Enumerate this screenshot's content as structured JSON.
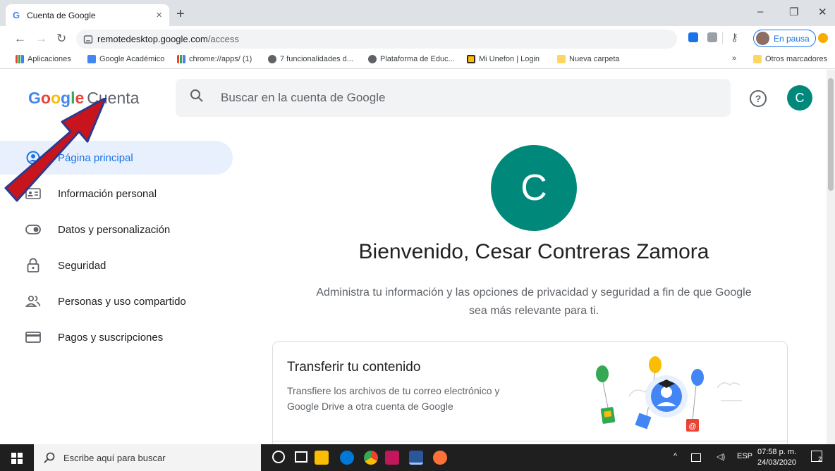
{
  "browser": {
    "tab_title": "Cuenta de Google",
    "tab_close": "×",
    "new_tab": "+",
    "window_minimize": "–",
    "window_restore": "❐",
    "window_close": "✕",
    "url_host": "remotedesktop.google.com",
    "url_path": "/access",
    "profile_status": "En pausa"
  },
  "bookmarks": [
    {
      "label": "Aplicaciones"
    },
    {
      "label": "Google Académico"
    },
    {
      "label": "chrome://apps/ (1)"
    },
    {
      "label": "7 funcionalidades d..."
    },
    {
      "label": "Plataforma de Educ..."
    },
    {
      "label": "Mi Unefon | Login"
    },
    {
      "label": "Nueva carpeta"
    }
  ],
  "bookmarks_overflow": "»",
  "other_bookmarks": "Otros marcadores",
  "header": {
    "logo_google": "Google",
    "logo_cuenta": "Cuenta",
    "search_placeholder": "Buscar en la cuenta de Google",
    "help": "?",
    "avatar_letter": "C"
  },
  "sidebar": {
    "items": [
      {
        "label": "Página principal",
        "icon": "account-circle-icon",
        "active": true
      },
      {
        "label": "Información personal",
        "icon": "id-card-icon"
      },
      {
        "label": "Datos y personalización",
        "icon": "toggle-icon"
      },
      {
        "label": "Seguridad",
        "icon": "lock-icon"
      },
      {
        "label": "Personas y uso compartido",
        "icon": "people-icon"
      },
      {
        "label": "Pagos y suscripciones",
        "icon": "credit-card-icon"
      }
    ]
  },
  "main": {
    "avatar_letter": "C",
    "welcome": "Bienvenido, Cesar Contreras Zamora",
    "subtitle_line1": "Administra tu información y las opciones de privacidad y seguridad a fin de que Google",
    "subtitle_line2": "sea más relevante para ti.",
    "card": {
      "title": "Transferir tu contenido",
      "desc_line1": "Transfiere los archivos de tu correo electrónico y",
      "desc_line2": "Google Drive a otra cuenta de Google"
    }
  },
  "taskbar": {
    "search_placeholder": "Escribe aquí para buscar",
    "language": "ESP",
    "time": "07:58 p. m.",
    "date": "24/03/2020",
    "notification_count": "2"
  },
  "colors": {
    "accent": "#1a73e8",
    "avatar": "#00897b",
    "arrow": "#c8151d"
  }
}
